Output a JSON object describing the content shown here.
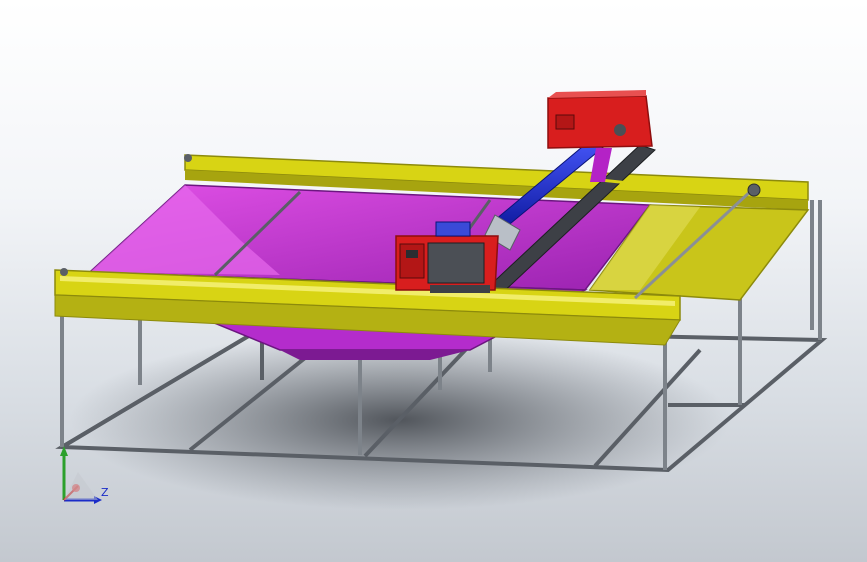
{
  "view": {
    "background_top": "#ffffff",
    "background_bottom": "#c3c8cf"
  },
  "colors": {
    "frame_steel": "#8a8f96",
    "frame_steel_dark": "#5a5f66",
    "rail_yellow": "#d8d414",
    "rail_yellow_dark": "#8c8a0c",
    "hopper_magenta": "#d23ad6",
    "hopper_magenta_dark": "#8a1f9c",
    "motor_red": "#d81e1e",
    "motor_red_dark": "#8e0d0d",
    "shaft_blue": "#1f2ed8",
    "shaft_blue_dark": "#0a1478",
    "gear_grey": "#4b4f55",
    "axis_x": "#2ca02c",
    "axis_y": "#2ca02c",
    "axis_z": "#1a2cc8"
  },
  "triad": {
    "z_label": "Z"
  },
  "parts": [
    {
      "name": "base-frame",
      "kind": "structural"
    },
    {
      "name": "support-legs",
      "kind": "structural"
    },
    {
      "name": "hopper-funnel",
      "kind": "body"
    },
    {
      "name": "front-rail",
      "kind": "rail"
    },
    {
      "name": "rear-rail",
      "kind": "rail"
    },
    {
      "name": "gantry-beam",
      "kind": "rail"
    },
    {
      "name": "drive-shaft",
      "kind": "shaft"
    },
    {
      "name": "upper-motor-box",
      "kind": "motor"
    },
    {
      "name": "lower-motor-box",
      "kind": "motor"
    },
    {
      "name": "cable-rod",
      "kind": "rod"
    }
  ]
}
